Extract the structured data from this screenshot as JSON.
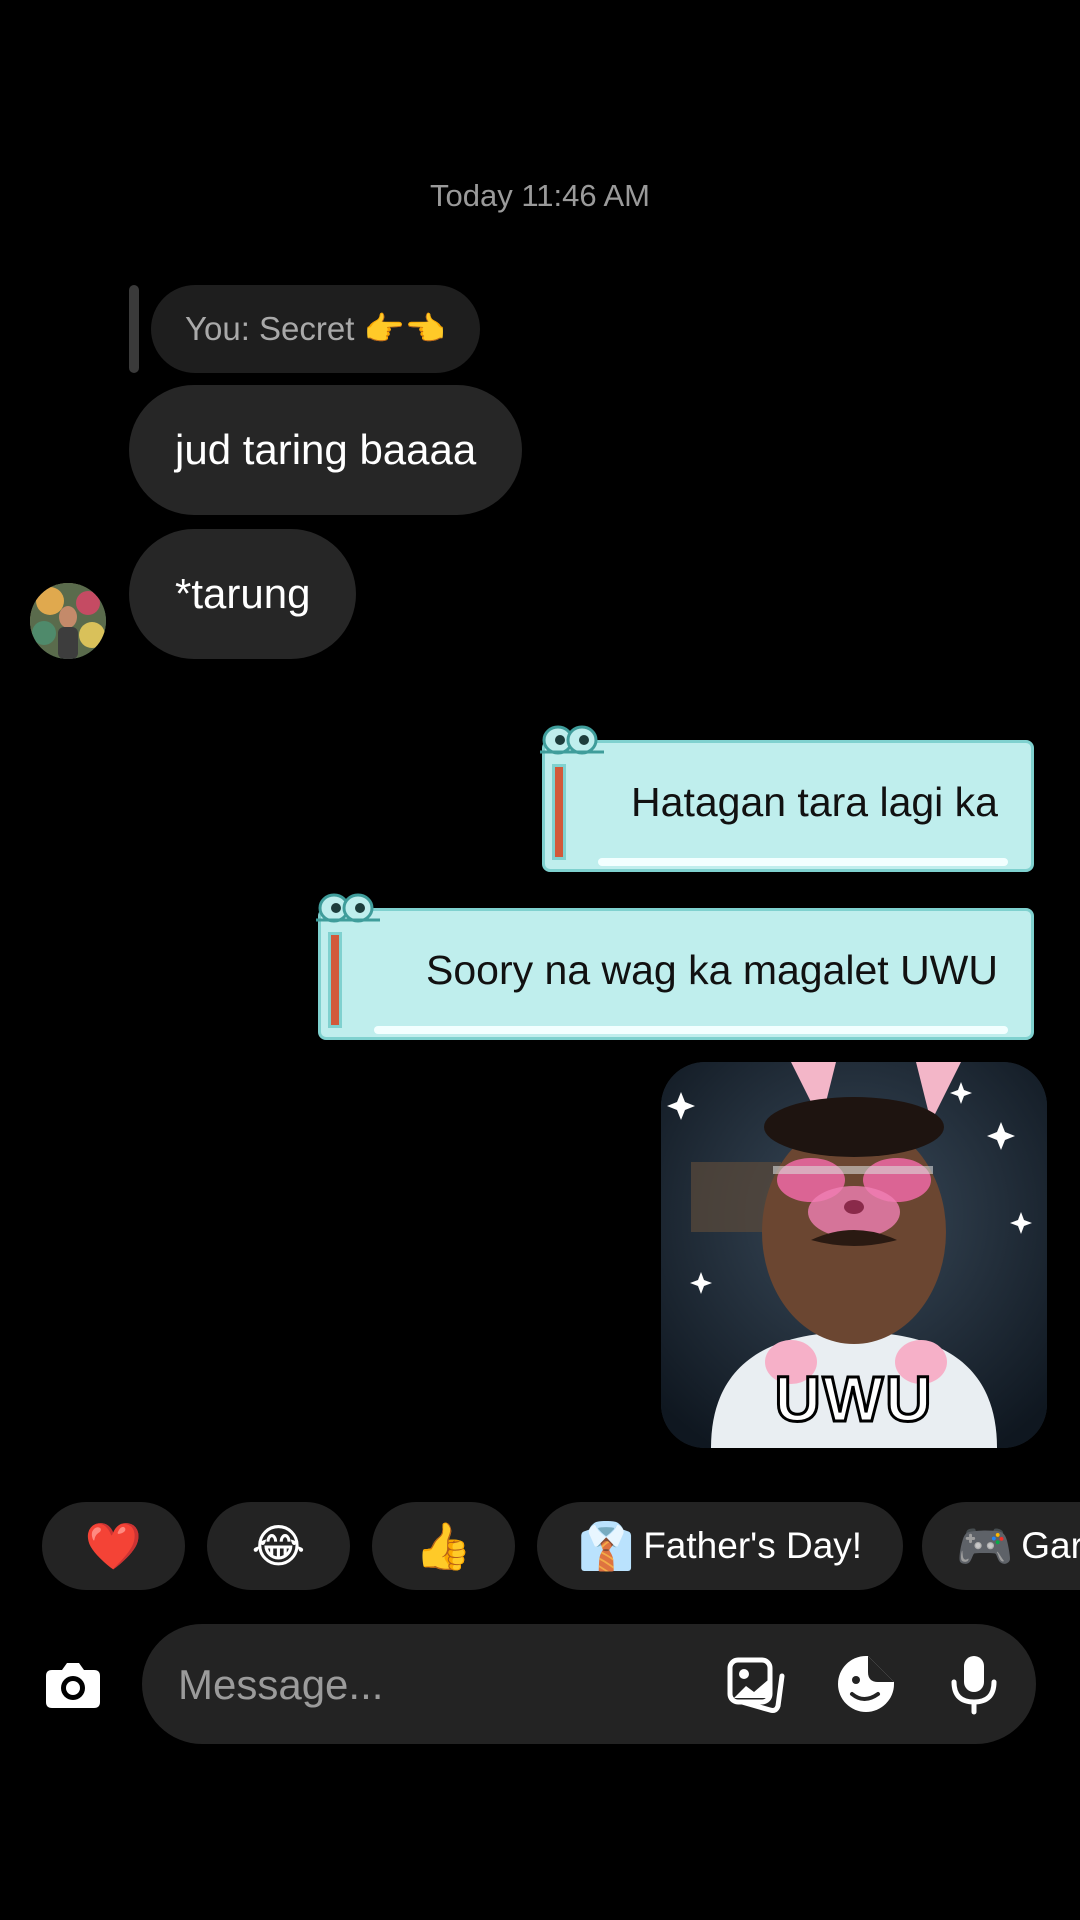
{
  "thread": {
    "timestamp": "Today 11:46 AM",
    "reply_preview": "You: Secret 👉👈",
    "incoming": [
      {
        "text": "jud taring baaaa"
      },
      {
        "text": "*tarung"
      }
    ],
    "outgoing": [
      {
        "text": "Hatagan tara lagi ka"
      },
      {
        "text": "Soory na wag ka magalet UWU"
      }
    ],
    "sticker_caption": "UWU"
  },
  "reactions": [
    {
      "emoji": "❤️",
      "label": ""
    },
    {
      "emoji": "😂",
      "label": ""
    },
    {
      "emoji": "👍",
      "label": ""
    },
    {
      "emoji": "👔",
      "label": "Father's Day!"
    },
    {
      "emoji": "🎮",
      "label": "Gar"
    }
  ],
  "composer": {
    "placeholder": "Message..."
  },
  "icons": {
    "camera": "camera-icon",
    "gallery": "gallery-icon",
    "sticker": "sticker-icon",
    "mic": "microphone-icon"
  },
  "colors": {
    "outgoing_bubble": "#bfeeed",
    "incoming_bubble": "#262626",
    "background": "#000000"
  }
}
